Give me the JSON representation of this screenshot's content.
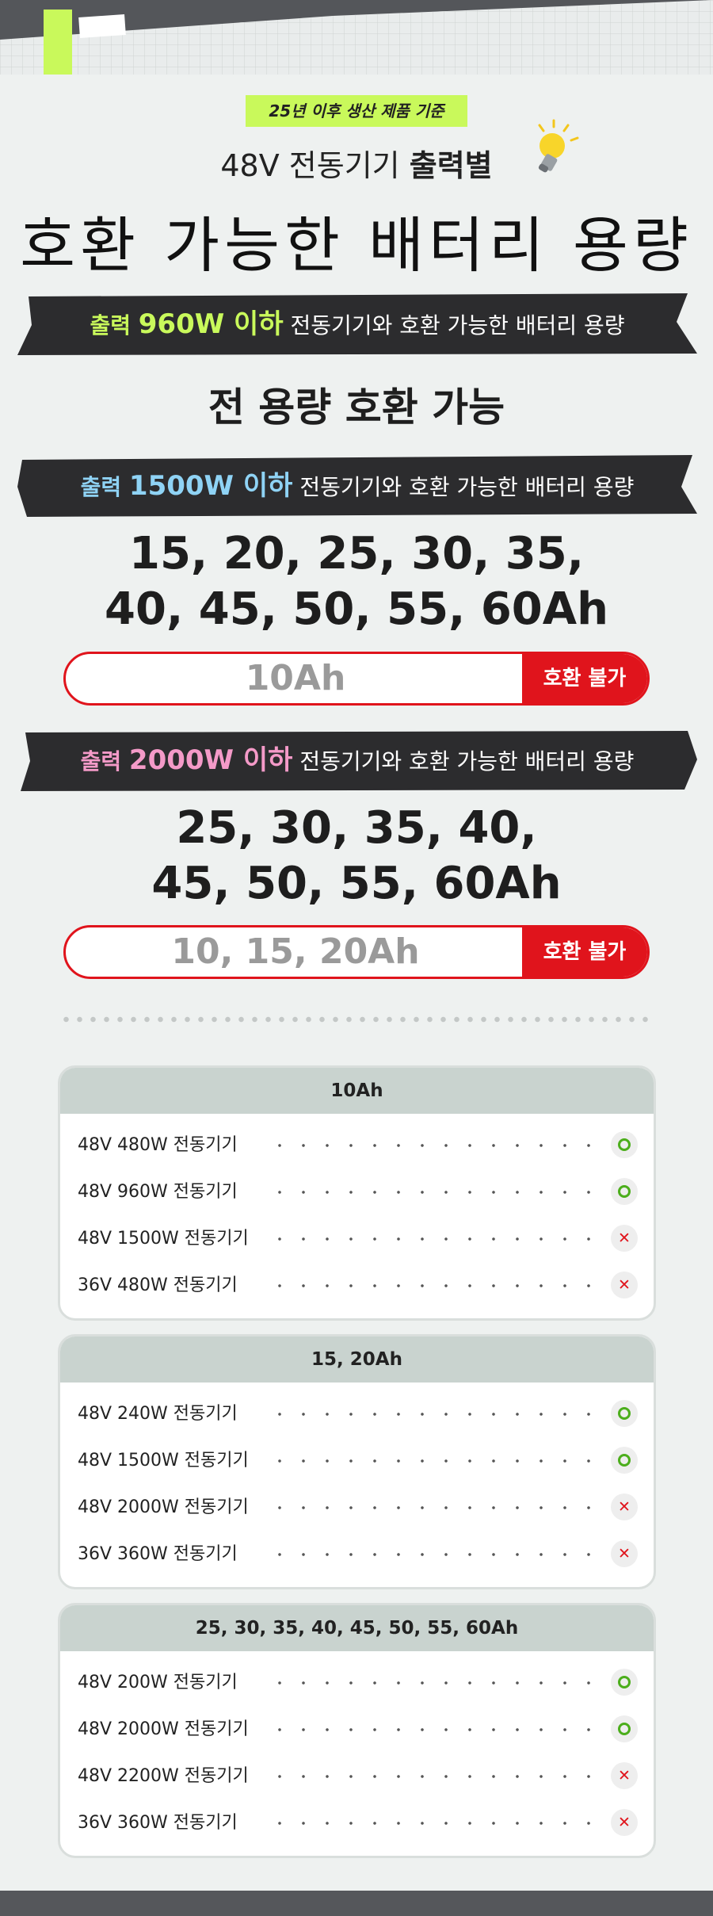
{
  "header": {
    "badge": "25년 이후 생산 제품 기준",
    "subtitle_prefix": "48V 전동기기 ",
    "subtitle_bold": "출력별",
    "headline": "호환 가능한 배터리 용량"
  },
  "sections": [
    {
      "ribbon_prefix": "출력 ",
      "ribbon_highlight": "960W 이하",
      "ribbon_suffix": " 전동기기와 호환 가능한 배터리 용량",
      "highlight_color": "#c9f95b",
      "compatible_line1": "전 용량 호환 가능",
      "compatible_line2": ""
    },
    {
      "ribbon_prefix": "출력 ",
      "ribbon_highlight": "1500W 이하",
      "ribbon_suffix": " 전동기기와 호환 가능한 배터리 용량",
      "highlight_color": "#8fd3f5",
      "compatible_line1": "15, 20, 25, 30, 35,",
      "compatible_line2": "40, 45, 50, 55, 60Ah",
      "incompatible_value": "10Ah",
      "incompatible_label": "호환 불가"
    },
    {
      "ribbon_prefix": "출력 ",
      "ribbon_highlight": "2000W 이하",
      "ribbon_suffix": " 전동기기와 호환 가능한 배터리 용량",
      "highlight_color": "#f49ac8",
      "compatible_line1": "25, 30, 35, 40,",
      "compatible_line2": "45, 50, 55, 60Ah",
      "incompatible_value": "10, 15, 20Ah",
      "incompatible_label": "호환 불가"
    }
  ],
  "cards": [
    {
      "title": "10Ah",
      "rows": [
        {
          "label": "48V 480W 전동기기",
          "status": "compatible"
        },
        {
          "label": "48V 960W 전동기기",
          "status": "compatible"
        },
        {
          "label": "48V 1500W 전동기기",
          "status": "incompatible"
        },
        {
          "label": "36V 480W 전동기기",
          "status": "incompatible"
        }
      ]
    },
    {
      "title": "15, 20Ah",
      "rows": [
        {
          "label": "48V 240W 전동기기",
          "status": "compatible"
        },
        {
          "label": "48V 1500W 전동기기",
          "status": "compatible"
        },
        {
          "label": "48V 2000W 전동기기",
          "status": "incompatible"
        },
        {
          "label": "36V 360W 전동기기",
          "status": "incompatible"
        }
      ]
    },
    {
      "title": "25, 30, 35, 40, 45, 50, 55, 60Ah",
      "rows": [
        {
          "label": "48V 200W 전동기기",
          "status": "compatible"
        },
        {
          "label": "48V 2000W 전동기기",
          "status": "compatible"
        },
        {
          "label": "48V 2200W 전동기기",
          "status": "incompatible"
        },
        {
          "label": "36V 360W 전동기기",
          "status": "incompatible"
        }
      ]
    }
  ],
  "colors": {
    "accent_red": "#e0141c",
    "badge_green": "#c9f95b",
    "ok_green": "#4cae1c"
  },
  "icons": {
    "compatible": "circle-ok-icon",
    "incompatible": "x-mark-icon",
    "header": "lightbulb-icon"
  }
}
